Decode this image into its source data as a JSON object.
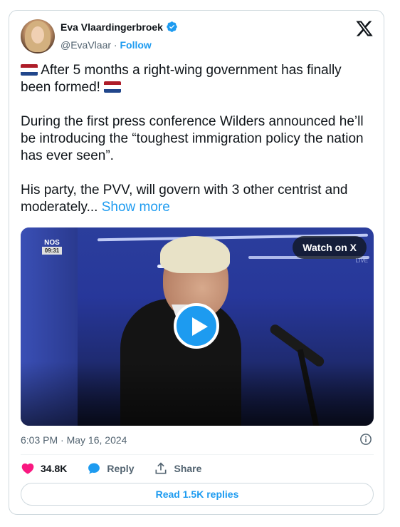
{
  "author": {
    "name": "Eva Vlaardingerbroek",
    "handle": "@EvaVlaar",
    "separator": "·",
    "follow_label": "Follow"
  },
  "tweet": {
    "line1": "After 5 months a right-wing government has finally been formed!",
    "para2": "During the first press conference Wilders announced he’ll be introducing the “toughest immigration policy the nation has ever seen”.",
    "para3": "His party, the PVV, will govern with 3 other centrist and moderately...",
    "show_more": "Show more"
  },
  "video": {
    "watch_label": "Watch on X",
    "channel": "NOS",
    "clock": "09:31",
    "live_tag": "LIVE"
  },
  "meta": {
    "time": "6:03 PM",
    "separator": "·",
    "date": "May 16, 2024"
  },
  "actions": {
    "likes": "34.8K",
    "reply_label": "Reply",
    "share_label": "Share",
    "read_replies_label": "Read 1.5K replies"
  },
  "colors": {
    "accent": "#1d9bf0",
    "like": "#f91880",
    "text_secondary": "#536471"
  }
}
